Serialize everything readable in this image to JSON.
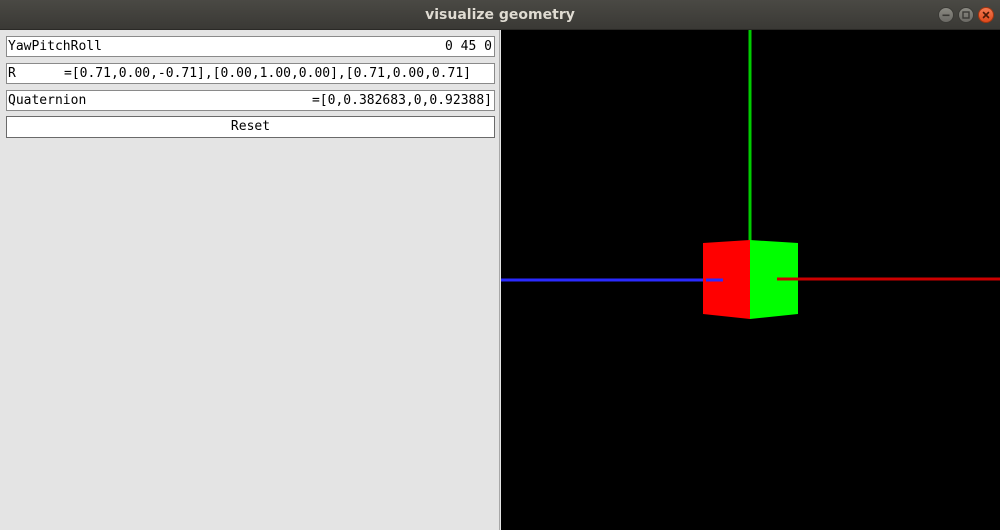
{
  "window": {
    "title": "visualize geometry"
  },
  "panel": {
    "ypr": {
      "label": "YawPitchRoll",
      "value": "0 45 0"
    },
    "rotation": {
      "label": "R",
      "value": "=[0.71,0.00,-0.71],[0.00,1.00,0.00],[0.71,0.00,0.71]"
    },
    "quaternion": {
      "label": "Quaternion",
      "value": "=[0,0.382683,0,0.92388]"
    },
    "reset_label": "Reset"
  },
  "viewport": {
    "axis_colors": {
      "x": "#cc0000",
      "y": "#00cc00",
      "z": "#2a2aff"
    },
    "cube_colors": {
      "left_face": "#ff0000",
      "right_face": "#00ff00"
    }
  }
}
